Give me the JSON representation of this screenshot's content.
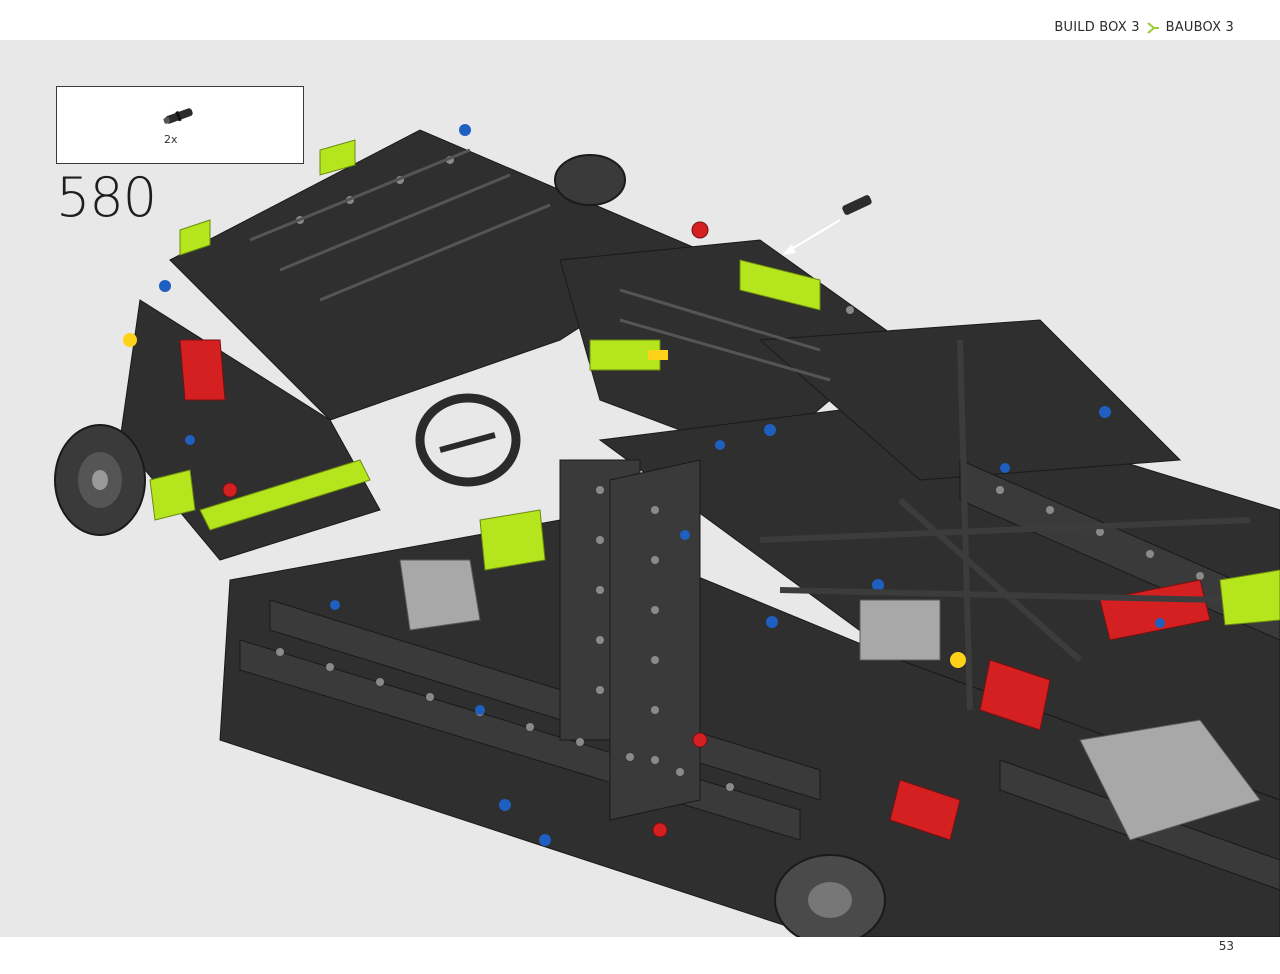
{
  "header": {
    "build_box": "BUILD BOX 3",
    "separator_icon": "lime-arrow-icon",
    "baubox": "BAUBOX 3",
    "accent_color": "#9acd32"
  },
  "parts_callout": {
    "quantity": "2x",
    "part_icon": "axle-pin-icon"
  },
  "step": {
    "number": "580"
  },
  "footer": {
    "page_number": "53"
  },
  "colors": {
    "background": "#e8e8e8",
    "dark_beam": "#2f2f2f",
    "lime": "#b5e61d",
    "red": "#d42020",
    "blue": "#1f5fbf",
    "light_gray": "#a8a8a8"
  }
}
